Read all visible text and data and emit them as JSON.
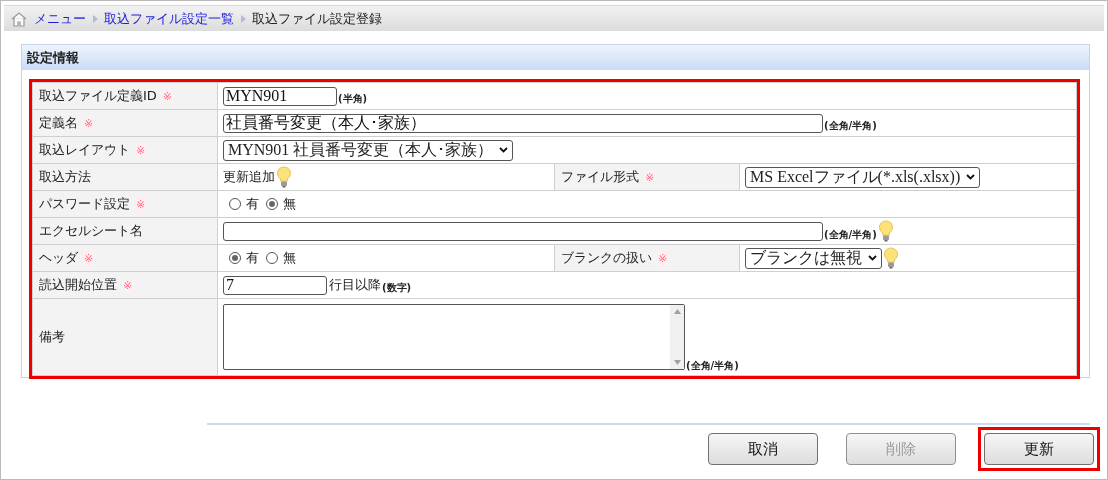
{
  "breadcrumb": [
    {
      "label": "メニュー",
      "link": true
    },
    {
      "label": "取込ファイル設定一覧",
      "link": true
    },
    {
      "label": "取込ファイル設定登録",
      "link": false
    }
  ],
  "section": {
    "title": "設定情報"
  },
  "rows": [
    {
      "cells": [
        {
          "label": "取込ファイル定義ID",
          "mark": "※",
          "field": {
            "kind": "short-input",
            "value": "MYN901",
            "note": "(半角)"
          }
        }
      ]
    },
    {
      "cells": [
        {
          "label": "定義名",
          "mark": "※",
          "field": {
            "kind": "long-input",
            "value": "社員番号変更（本人･家族）",
            "note": "(全角/半角)"
          }
        }
      ]
    },
    {
      "cells": [
        {
          "label": "取込レイアウト",
          "mark": "※",
          "field": {
            "kind": "select",
            "value": "MYN901 社員番号変更（本人･家族）"
          }
        }
      ]
    },
    {
      "cells": [
        {
          "label": "取込方法",
          "field": {
            "kind": "text",
            "value": "更新追加",
            "hint": true
          }
        },
        {
          "label": "ファイル形式",
          "mark": "※",
          "field": {
            "kind": "select",
            "value": "MS Excelファイル(*.xls(.xlsx))"
          }
        }
      ]
    },
    {
      "cells": [
        {
          "label": "パスワード設定",
          "mark": "※",
          "field": {
            "kind": "radio",
            "options": [
              {
                "label": "有",
                "selected": false
              },
              {
                "label": "無",
                "selected": true
              }
            ]
          }
        }
      ]
    },
    {
      "cells": [
        {
          "label": "エクセルシート名",
          "field": {
            "kind": "long-input",
            "note": "(全角/半角)",
            "hint": true
          }
        }
      ]
    },
    {
      "cells": [
        {
          "label": "ヘッダ",
          "mark": "※",
          "field": {
            "kind": "radio",
            "options": [
              {
                "label": "有",
                "selected": true
              },
              {
                "label": "無",
                "selected": false
              }
            ]
          }
        },
        {
          "label": "ブランクの扱い",
          "mark": "※",
          "field": {
            "kind": "select",
            "value": "ブランクは無視",
            "hint": true
          }
        }
      ]
    },
    {
      "cells": [
        {
          "label": "読込開始位置",
          "mark": "※",
          "field": {
            "kind": "number-input",
            "value": "7",
            "suffix": "行目以降",
            "note": "(数字)"
          }
        }
      ]
    },
    {
      "cells": [
        {
          "label": "備考",
          "field": {
            "kind": "textarea",
            "note": "(全角/半角)"
          }
        }
      ]
    }
  ],
  "buttons": [
    {
      "label": "取消",
      "disabled": false,
      "highlighted": false
    },
    {
      "label": "削除",
      "disabled": true,
      "highlighted": false
    },
    {
      "label": "更新",
      "disabled": false,
      "highlighted": true
    }
  ]
}
